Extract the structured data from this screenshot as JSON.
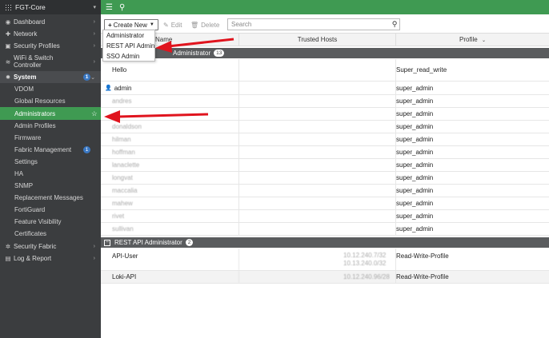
{
  "sidebar": {
    "device": "FGT-Core",
    "items": [
      {
        "label": "Dashboard"
      },
      {
        "label": "Network"
      },
      {
        "label": "Security Profiles"
      },
      {
        "label": "WiFi & Switch Controller"
      },
      {
        "label": "System",
        "badge": "1"
      },
      {
        "label": "VDOM"
      },
      {
        "label": "Global Resources"
      },
      {
        "label": "Administrators"
      },
      {
        "label": "Admin Profiles"
      },
      {
        "label": "Firmware"
      },
      {
        "label": "Fabric Management",
        "badge": "1"
      },
      {
        "label": "Settings"
      },
      {
        "label": "HA"
      },
      {
        "label": "SNMP"
      },
      {
        "label": "Replacement Messages"
      },
      {
        "label": "FortiGuard"
      },
      {
        "label": "Feature Visibility"
      },
      {
        "label": "Certificates"
      },
      {
        "label": "Security Fabric"
      },
      {
        "label": "Log & Report"
      }
    ]
  },
  "toolbar": {
    "create_new": "Create New",
    "edit": "Edit",
    "delete": "Delete",
    "search_placeholder": "Search"
  },
  "dropdown": {
    "items": [
      "Administrator",
      "REST API Admin",
      "SSO Admin"
    ]
  },
  "table": {
    "columns": {
      "name": "Name",
      "hosts": "Trusted Hosts",
      "profile": "Profile"
    },
    "groups": [
      {
        "label": "Administrator",
        "count": "13",
        "rows": [
          {
            "name": "Hello",
            "profile": "Super_read_write"
          },
          {
            "name": "admin",
            "profile": "super_admin"
          },
          {
            "name": "andres",
            "profile": "super_admin"
          },
          {
            "name": "",
            "profile": "super_admin"
          },
          {
            "name": "donaldson",
            "profile": "super_admin"
          },
          {
            "name": "hilman",
            "profile": "super_admin"
          },
          {
            "name": "hoffman",
            "profile": "super_admin"
          },
          {
            "name": "lanaclette",
            "profile": "super_admin"
          },
          {
            "name": "longvat",
            "profile": "super_admin"
          },
          {
            "name": "maccalia",
            "profile": "super_admin"
          },
          {
            "name": "mahew",
            "profile": "super_admin"
          },
          {
            "name": "rivet",
            "profile": "super_admin"
          },
          {
            "name": "sullivan",
            "profile": "super_admin"
          }
        ]
      },
      {
        "label": "REST API Administrator",
        "count": "2",
        "rows": [
          {
            "name": "API-User",
            "hosts": [
              "10.12.240.7/32",
              "10.13.240.0/32"
            ],
            "profile": "Read-Write-Profile"
          },
          {
            "name": "Loki-API",
            "hosts": [
              "10.12.240.96/28"
            ],
            "profile": "Read-Write-Profile"
          }
        ]
      }
    ]
  },
  "annotation_color": "#e0141e"
}
